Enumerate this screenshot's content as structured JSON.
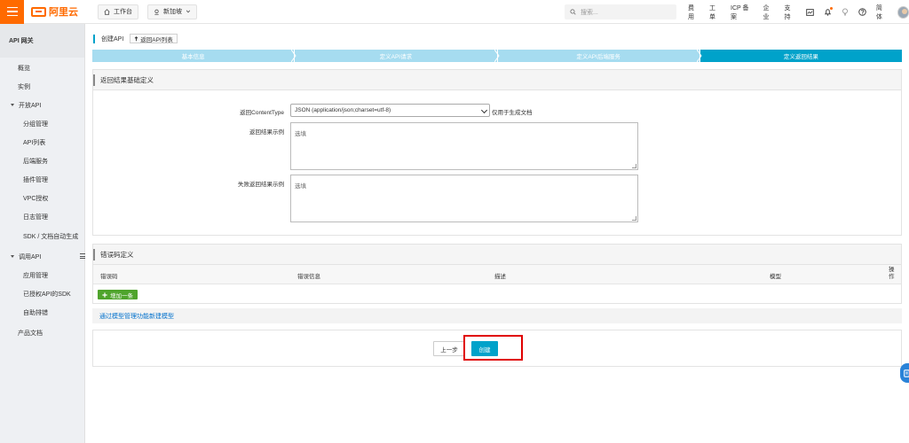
{
  "topbar": {
    "logo_text": "阿里云",
    "workbench": "工作台",
    "region": "新加坡",
    "search_placeholder": "搜索...",
    "nav": [
      "费用",
      "工单",
      "ICP 备案",
      "企业",
      "支持"
    ],
    "lang": "简体"
  },
  "sidebar": {
    "title": "API 网关",
    "items": [
      {
        "label": "概览",
        "level": "l1"
      },
      {
        "label": "实例",
        "level": "l1"
      },
      {
        "label": "开放API",
        "level": "group"
      },
      {
        "label": "分组管理",
        "level": "l2"
      },
      {
        "label": "API列表",
        "level": "l2"
      },
      {
        "label": "后端服务",
        "level": "l2"
      },
      {
        "label": "插件管理",
        "level": "l2"
      },
      {
        "label": "VPC授权",
        "level": "l2"
      },
      {
        "label": "日志管理",
        "level": "l2"
      },
      {
        "label": "SDK / 文档自动生成",
        "level": "l2"
      },
      {
        "label": "调用API",
        "level": "group"
      },
      {
        "label": "应用管理",
        "level": "l2"
      },
      {
        "label": "已授权API的SDK",
        "level": "l2"
      },
      {
        "label": "自助排错",
        "level": "l2"
      },
      {
        "label": "产品文档",
        "level": "l1"
      }
    ]
  },
  "breadcrumb": {
    "title": "创建API",
    "back": "返回API列表"
  },
  "steps": [
    "基本信息",
    "定义API请求",
    "定义API后端服务",
    "定义返回结果"
  ],
  "result_panel": {
    "title": "返回结果基础定义",
    "content_type_label": "返回ContentType",
    "content_type_value": "JSON (application/json;charset=utf-8)",
    "content_type_hint": "仅用于生成文档",
    "success_label": "返回结果示例",
    "success_placeholder": "选填",
    "fail_label": "失败返回结果示例",
    "fail_placeholder": "选填"
  },
  "error_panel": {
    "title": "错误码定义",
    "columns": [
      "错误码",
      "错误信息",
      "描述",
      "模型",
      "操作"
    ],
    "add_button": "增加一条"
  },
  "model_link": "通过模型管理功能新建模型",
  "actions": {
    "prev": "上一步",
    "create": "创建"
  },
  "colors": {
    "brand": "#ff6a00",
    "accent": "#00a2ca",
    "step_inactive": "#a6dcf0",
    "add_green": "#4fa42c",
    "highlight": "#e00000"
  }
}
